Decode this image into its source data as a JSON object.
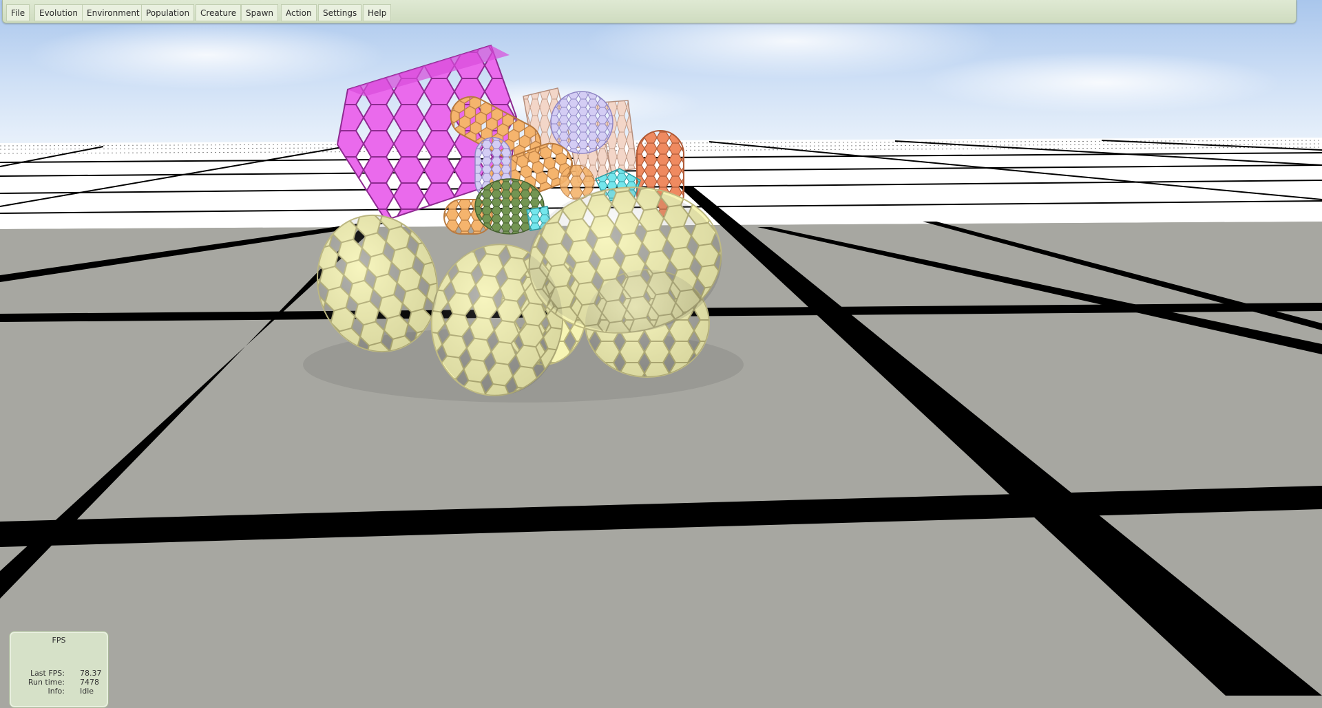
{
  "menu": {
    "items": [
      {
        "id": "file",
        "label": "File"
      },
      {
        "id": "evolution",
        "label": "Evolution"
      },
      {
        "id": "environment",
        "label": "Environment"
      },
      {
        "id": "population",
        "label": "Population"
      },
      {
        "id": "creature",
        "label": "Creature"
      },
      {
        "id": "spawn",
        "label": "Spawn"
      },
      {
        "id": "action",
        "label": "Action"
      },
      {
        "id": "settings",
        "label": "Settings"
      },
      {
        "id": "help",
        "label": "Help"
      }
    ]
  },
  "fps_panel": {
    "title": "FPS",
    "rows": [
      {
        "label": "Last FPS:",
        "value": "78.37"
      },
      {
        "label": "Run time:",
        "value": "7478"
      },
      {
        "label": "Info:",
        "value": "Idle"
      }
    ]
  },
  "scene": {
    "sky_color": "#bcd6f3",
    "floor_color": "#a7a7a1",
    "grid_line_color": "#000000",
    "creature_colors": {
      "yellow_body": "#f3f1a6",
      "magenta_cube": "#e65ae8",
      "orange_capsule": "#f3ac63",
      "coral_capsule": "#ef865c",
      "peach_block": "#f2cfbf",
      "lavender": "#cbc2f0",
      "green": "#6d8f50",
      "cyan": "#6fe4ea"
    }
  }
}
